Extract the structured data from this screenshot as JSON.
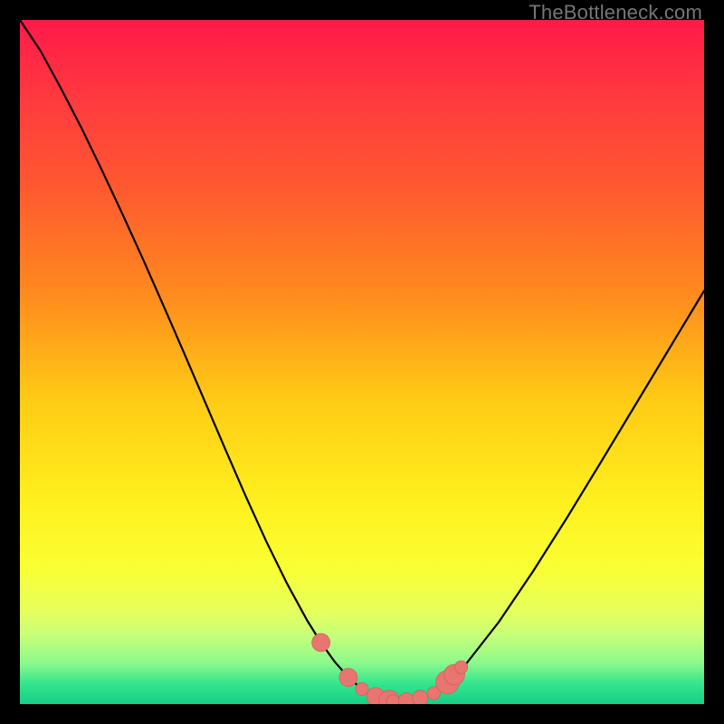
{
  "watermark": "TheBottleneck.com",
  "colors": {
    "frame": "#000000",
    "curve": "#000000",
    "marker_fill": "#e8756f",
    "marker_stroke": "#cb5a55"
  },
  "gradient_stops": [
    {
      "offset": 0.0,
      "color": "#ff1a49"
    },
    {
      "offset": 0.12,
      "color": "#ff3b3e"
    },
    {
      "offset": 0.25,
      "color": "#ff5a30"
    },
    {
      "offset": 0.4,
      "color": "#ff8a1e"
    },
    {
      "offset": 0.55,
      "color": "#ffc915"
    },
    {
      "offset": 0.7,
      "color": "#ffef1e"
    },
    {
      "offset": 0.8,
      "color": "#f9ff33"
    },
    {
      "offset": 0.86,
      "color": "#e8ff5a"
    },
    {
      "offset": 0.9,
      "color": "#c7ff7a"
    },
    {
      "offset": 0.94,
      "color": "#8cf98c"
    },
    {
      "offset": 0.97,
      "color": "#35e58d"
    },
    {
      "offset": 1.0,
      "color": "#18cf87"
    }
  ],
  "chart_data": {
    "type": "line",
    "title": "",
    "xlabel": "",
    "ylabel": "",
    "xlim": [
      0,
      100
    ],
    "ylim": [
      0,
      100
    ],
    "curve": {
      "x": [
        0,
        3,
        6,
        9,
        12,
        15,
        18,
        21,
        24,
        27,
        30,
        33,
        36,
        39,
        42,
        44,
        46,
        48,
        50,
        52,
        54,
        56,
        58,
        60,
        62,
        65,
        70,
        75,
        80,
        85,
        90,
        95,
        100
      ],
      "y": [
        100,
        95.5,
        90.0,
        84.2,
        78.0,
        71.6,
        65.0,
        58.2,
        51.3,
        44.3,
        37.3,
        30.4,
        23.8,
        17.7,
        12.2,
        9.0,
        6.2,
        3.9,
        2.2,
        1.1,
        0.5,
        0.4,
        0.6,
        1.4,
        2.8,
        5.6,
        12.0,
        19.4,
        27.3,
        35.5,
        43.8,
        52.1,
        60.4
      ]
    },
    "markers": [
      {
        "x": 44.0,
        "y": 9.0,
        "r": 1.4
      },
      {
        "x": 48.0,
        "y": 3.9,
        "r": 1.4
      },
      {
        "x": 50.0,
        "y": 2.2,
        "r": 1.0
      },
      {
        "x": 52.0,
        "y": 1.1,
        "r": 1.4
      },
      {
        "x": 54.0,
        "y": 0.5,
        "r": 1.6
      },
      {
        "x": 54.5,
        "y": 0.4,
        "r": 1.0
      },
      {
        "x": 56.5,
        "y": 0.5,
        "r": 1.2
      },
      {
        "x": 58.5,
        "y": 0.9,
        "r": 1.2
      },
      {
        "x": 60.5,
        "y": 1.6,
        "r": 1.0
      },
      {
        "x": 62.5,
        "y": 3.2,
        "r": 1.8
      },
      {
        "x": 63.5,
        "y": 4.3,
        "r": 1.6
      },
      {
        "x": 64.5,
        "y": 5.4,
        "r": 1.0
      }
    ]
  }
}
